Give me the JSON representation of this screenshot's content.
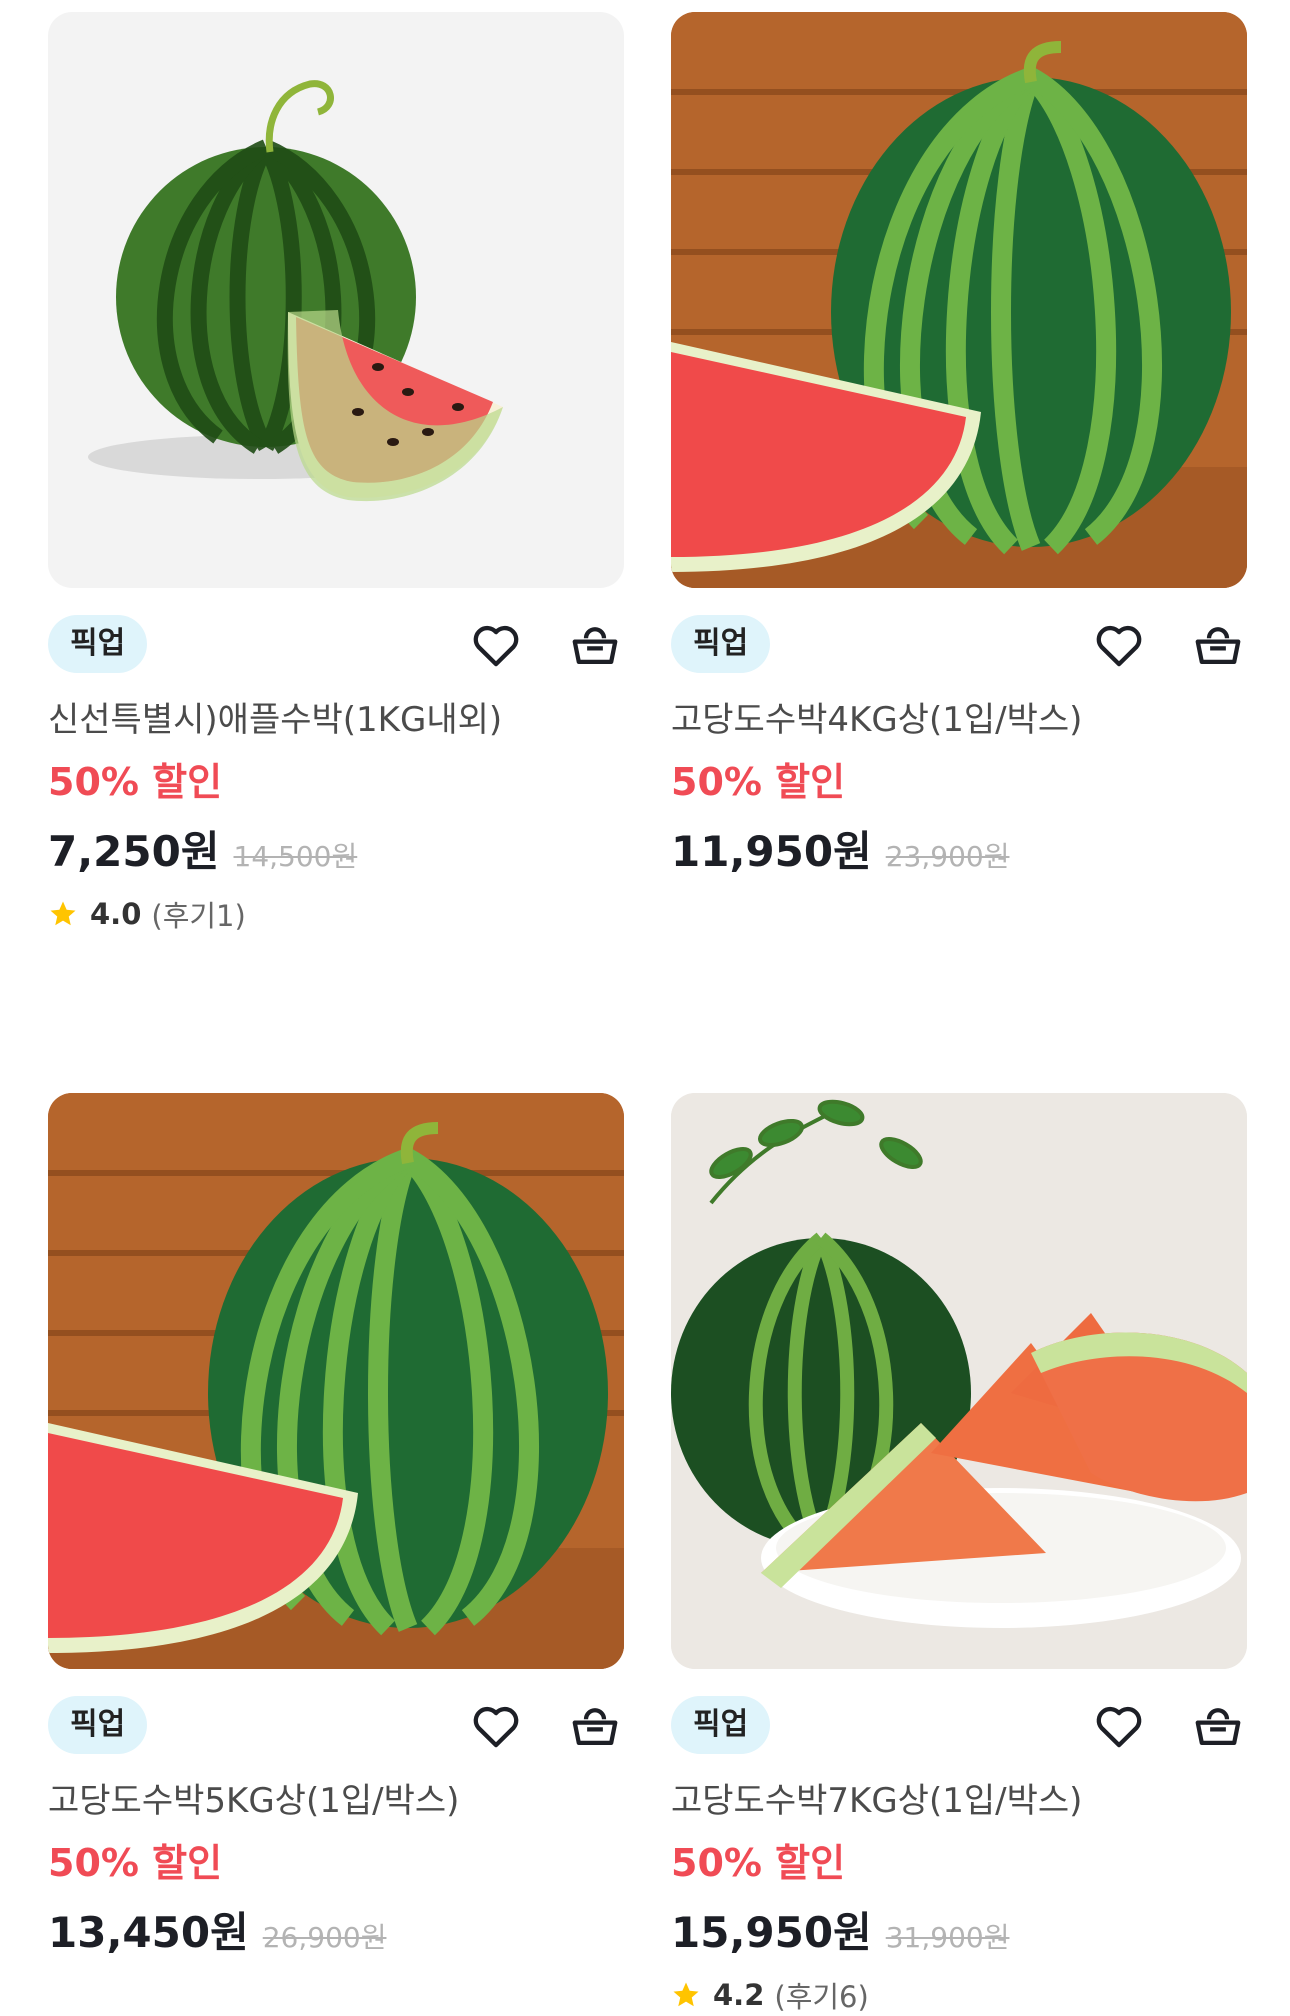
{
  "products": [
    {
      "badge": "픽업",
      "title": "신선특별시)애플수박(1KG내외)",
      "discount": "50% 할인",
      "price": "7,250원",
      "original_price": "14,500원",
      "rating": "4.0",
      "reviews": "(후기1)",
      "image_icon": "watermslice-gray-bg"
    },
    {
      "badge": "픽업",
      "title": "고당도수박4KG상(1입/박스)",
      "discount": "50% 할인",
      "price": "11,950원",
      "original_price": "23,900원",
      "image_icon": "watermelon-wood-bg"
    },
    {
      "badge": "픽업",
      "title": "고당도수박5KG상(1입/박스)",
      "discount": "50% 할인",
      "price": "13,450원",
      "original_price": "26,900원",
      "image_icon": "watermelon-wood-bg"
    },
    {
      "badge": "픽업",
      "title": "고당도수박7KG상(1입/박스)",
      "discount": "50% 할인",
      "price": "15,950원",
      "original_price": "31,900원",
      "rating": "4.2",
      "reviews": "(후기6)",
      "image_icon": "watermelon-plate-bg"
    }
  ],
  "colors": {
    "discount": "#f04b55",
    "badge_bg": "#dff4fb",
    "star": "#ffc400"
  }
}
